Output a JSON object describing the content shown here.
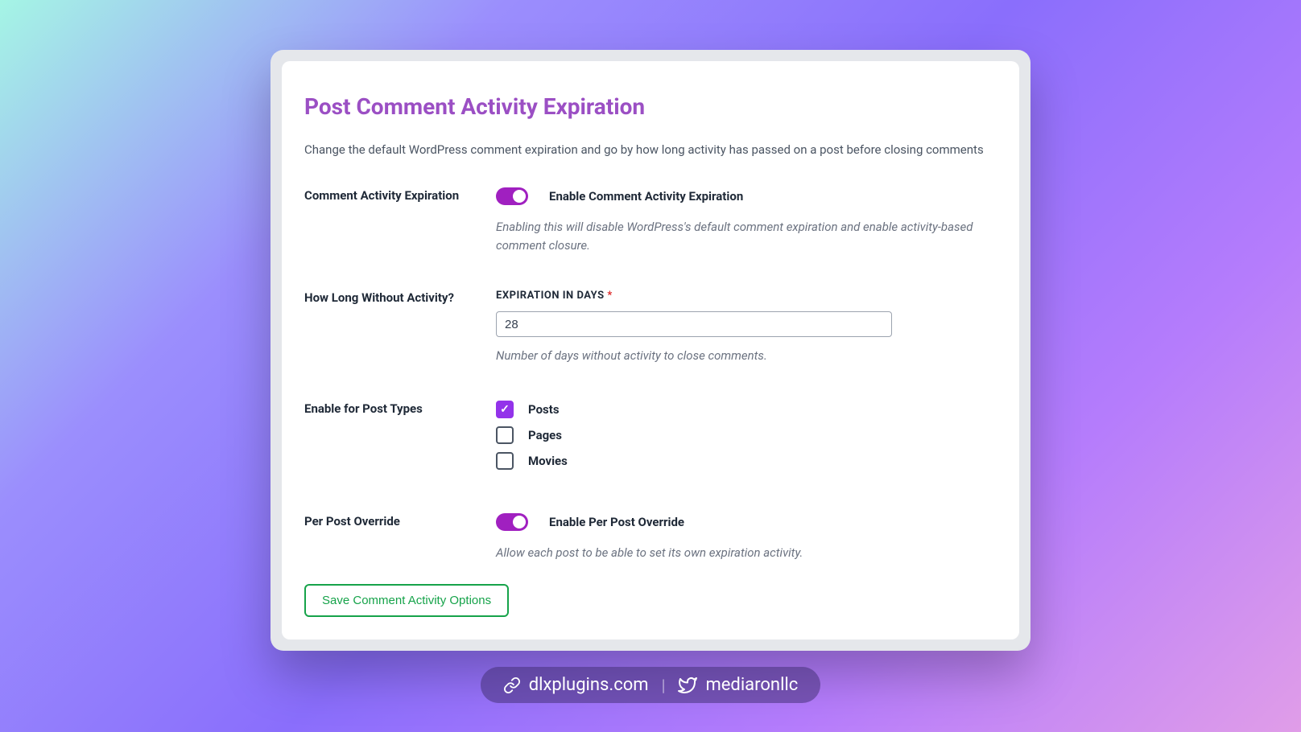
{
  "title": "Post Comment Activity Expiration",
  "subtitle": "Change the default WordPress comment expiration and go by how long activity has passed on a post before closing comments",
  "fields": {
    "activity_expiration": {
      "label": "Comment Activity Expiration",
      "toggle_label": "Enable Comment Activity Expiration",
      "help": "Enabling this will disable WordPress's default comment expiration and enable activity-based comment closure."
    },
    "how_long": {
      "label": "How Long Without Activity?",
      "input_label": "Expiration in Days",
      "required_marker": "*",
      "value": "28",
      "help": "Number of days without activity to close comments."
    },
    "post_types": {
      "label": "Enable for Post Types",
      "options": {
        "posts": "Posts",
        "pages": "Pages",
        "movies": "Movies"
      }
    },
    "per_post": {
      "label": "Per Post Override",
      "toggle_label": "Enable Per Post Override",
      "help": "Allow each post to be able to set its own expiration activity."
    }
  },
  "save_button": "Save Comment Activity Options",
  "footer": {
    "link1": "dlxplugins.com",
    "link2": "mediaronllc"
  }
}
